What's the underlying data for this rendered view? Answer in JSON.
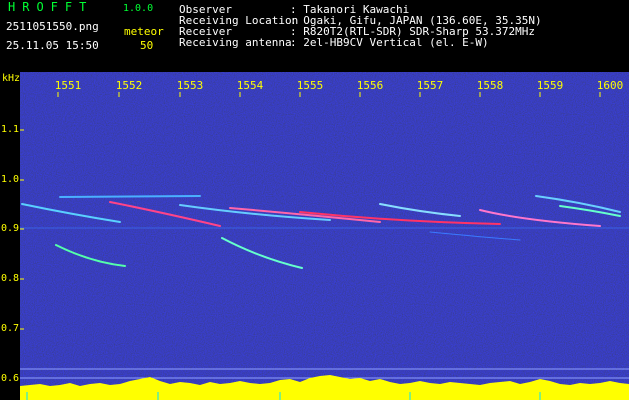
{
  "header": {
    "app_title": "HROFFT",
    "version": "1.0.0",
    "filename": "2511051550.png",
    "datetime": "25.11.05 15:50",
    "meteor_label": "meteor",
    "meteor_count": "50",
    "info": [
      {
        "label": "Observer",
        "value": ": Takanori Kawachi"
      },
      {
        "label": "Receiving Location",
        "value": ": Ogaki, Gifu, JAPAN (136.60E, 35.35N)"
      },
      {
        "label": "Receiver",
        "value": ": R820T2(RTL-SDR) SDR-Sharp 53.372MHz"
      },
      {
        "label": "Receiving antenna",
        "value": ": 2el-HB9CV Vertical (el. E-W)"
      }
    ]
  },
  "axis": {
    "unit": "kHz",
    "x_ticks": [
      "1551",
      "1552",
      "1553",
      "1554",
      "1555",
      "1556",
      "1557",
      "1558",
      "1559",
      "1600"
    ],
    "y_ticks": [
      "1.1",
      "1.0",
      "0.9",
      "0.8",
      "0.7",
      "0.6"
    ]
  },
  "colors": {
    "background": "#000000",
    "spectrum": "#0a0a40",
    "label_green": "#00ff33",
    "label_yellow": "#ffff00",
    "signal": "#ff3366",
    "carrier": "#80c0ff"
  }
}
